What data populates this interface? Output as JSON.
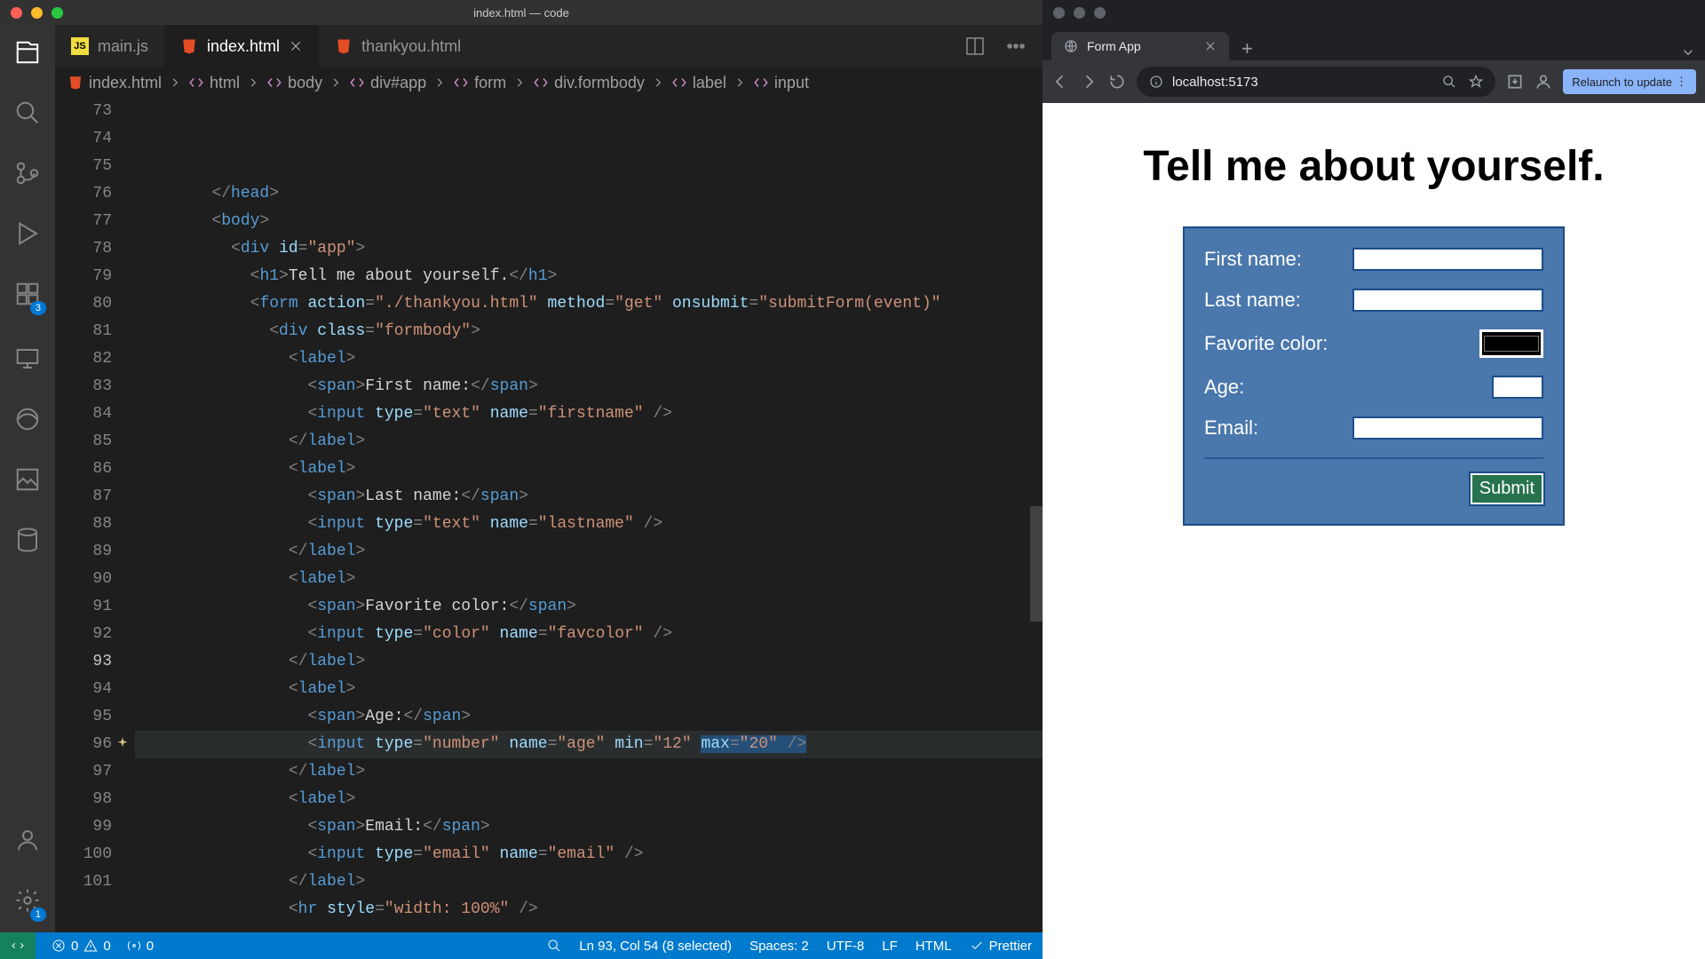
{
  "vscode": {
    "titlebar": "index.html — code",
    "tabs": [
      {
        "label": "main.js",
        "icon_color": "#f1dd3f",
        "icon_text": "JS",
        "active": false,
        "close": false
      },
      {
        "label": "index.html",
        "icon_color": "#e44d26",
        "active": true,
        "close": true
      },
      {
        "label": "thankyou.html",
        "icon_color": "#e44d26",
        "active": false,
        "close": false
      }
    ],
    "breadcrumbs": [
      {
        "label": "index.html",
        "kind": "file"
      },
      {
        "label": "html",
        "kind": "tag"
      },
      {
        "label": "body",
        "kind": "tag"
      },
      {
        "label": "div#app",
        "kind": "tag"
      },
      {
        "label": "form",
        "kind": "tag"
      },
      {
        "label": "div.formbody",
        "kind": "tag"
      },
      {
        "label": "label",
        "kind": "tag"
      },
      {
        "label": "input",
        "kind": "tag"
      }
    ],
    "activity_badges": {
      "extensions": "3",
      "settings": "1"
    },
    "code": {
      "first_line": 73,
      "cursor_line": 93,
      "lines": [
        {
          "n": 73,
          "indent": 8,
          "tokens": [
            "</",
            "head",
            ">"
          ],
          "kinds": [
            "punc",
            "tag",
            "punc"
          ]
        },
        {
          "n": 74,
          "indent": 8,
          "tokens": [
            "<",
            "body",
            ">"
          ],
          "kinds": [
            "punc",
            "tag",
            "punc"
          ]
        },
        {
          "n": 75,
          "indent": 10,
          "tokens": [
            "<",
            "div",
            " ",
            "id",
            "=",
            "\"app\"",
            ">"
          ],
          "kinds": [
            "punc",
            "tag",
            "txt",
            "attr",
            "punc",
            "str",
            "punc"
          ]
        },
        {
          "n": 76,
          "indent": 12,
          "tokens": [
            "<",
            "h1",
            ">",
            "Tell me about yourself.",
            "</",
            "h1",
            ">"
          ],
          "kinds": [
            "punc",
            "tag",
            "punc",
            "txt",
            "punc",
            "tag",
            "punc"
          ]
        },
        {
          "n": 77,
          "indent": 12,
          "tokens": [
            "<",
            "form",
            " ",
            "action",
            "=",
            "\"./thankyou.html\"",
            " ",
            "method",
            "=",
            "\"get\"",
            " ",
            "onsubmit",
            "=",
            "\"submitForm(event)\""
          ],
          "kinds": [
            "punc",
            "tag",
            "txt",
            "attr",
            "punc",
            "str",
            "txt",
            "attr",
            "punc",
            "str",
            "txt",
            "attr",
            "punc",
            "str"
          ]
        },
        {
          "n": 78,
          "indent": 14,
          "tokens": [
            "<",
            "div",
            " ",
            "class",
            "=",
            "\"formbody\"",
            ">"
          ],
          "kinds": [
            "punc",
            "tag",
            "txt",
            "attr",
            "punc",
            "str",
            "punc"
          ]
        },
        {
          "n": 79,
          "indent": 16,
          "tokens": [
            "<",
            "label",
            ">"
          ],
          "kinds": [
            "punc",
            "tag",
            "punc"
          ]
        },
        {
          "n": 80,
          "indent": 18,
          "tokens": [
            "<",
            "span",
            ">",
            "First name:",
            "</",
            "span",
            ">"
          ],
          "kinds": [
            "punc",
            "tag",
            "punc",
            "txt",
            "punc",
            "tag",
            "punc"
          ]
        },
        {
          "n": 81,
          "indent": 18,
          "tokens": [
            "<",
            "input",
            " ",
            "type",
            "=",
            "\"text\"",
            " ",
            "name",
            "=",
            "\"firstname\"",
            " />"
          ],
          "kinds": [
            "punc",
            "tag",
            "txt",
            "attr",
            "punc",
            "str",
            "txt",
            "attr",
            "punc",
            "str",
            "punc"
          ]
        },
        {
          "n": 82,
          "indent": 16,
          "tokens": [
            "</",
            "label",
            ">"
          ],
          "kinds": [
            "punc",
            "tag",
            "punc"
          ]
        },
        {
          "n": 83,
          "indent": 16,
          "tokens": [
            "<",
            "label",
            ">"
          ],
          "kinds": [
            "punc",
            "tag",
            "punc"
          ]
        },
        {
          "n": 84,
          "indent": 18,
          "tokens": [
            "<",
            "span",
            ">",
            "Last name:",
            "</",
            "span",
            ">"
          ],
          "kinds": [
            "punc",
            "tag",
            "punc",
            "txt",
            "punc",
            "tag",
            "punc"
          ]
        },
        {
          "n": 85,
          "indent": 18,
          "tokens": [
            "<",
            "input",
            " ",
            "type",
            "=",
            "\"text\"",
            " ",
            "name",
            "=",
            "\"lastname\"",
            " />"
          ],
          "kinds": [
            "punc",
            "tag",
            "txt",
            "attr",
            "punc",
            "str",
            "txt",
            "attr",
            "punc",
            "str",
            "punc"
          ]
        },
        {
          "n": 86,
          "indent": 16,
          "tokens": [
            "</",
            "label",
            ">"
          ],
          "kinds": [
            "punc",
            "tag",
            "punc"
          ]
        },
        {
          "n": 87,
          "indent": 16,
          "tokens": [
            "<",
            "label",
            ">"
          ],
          "kinds": [
            "punc",
            "tag",
            "punc"
          ]
        },
        {
          "n": 88,
          "indent": 18,
          "tokens": [
            "<",
            "span",
            ">",
            "Favorite color:",
            "</",
            "span",
            ">"
          ],
          "kinds": [
            "punc",
            "tag",
            "punc",
            "txt",
            "punc",
            "tag",
            "punc"
          ]
        },
        {
          "n": 89,
          "indent": 18,
          "tokens": [
            "<",
            "input",
            " ",
            "type",
            "=",
            "\"color\"",
            " ",
            "name",
            "=",
            "\"favcolor\"",
            " />"
          ],
          "kinds": [
            "punc",
            "tag",
            "txt",
            "attr",
            "punc",
            "str",
            "txt",
            "attr",
            "punc",
            "str",
            "punc"
          ]
        },
        {
          "n": 90,
          "indent": 16,
          "tokens": [
            "</",
            "label",
            ">"
          ],
          "kinds": [
            "punc",
            "tag",
            "punc"
          ]
        },
        {
          "n": 91,
          "indent": 16,
          "tokens": [
            "<",
            "label",
            ">"
          ],
          "kinds": [
            "punc",
            "tag",
            "punc"
          ]
        },
        {
          "n": 92,
          "indent": 18,
          "tokens": [
            "<",
            "span",
            ">",
            "Age:",
            "</",
            "span",
            ">"
          ],
          "kinds": [
            "punc",
            "tag",
            "punc",
            "txt",
            "punc",
            "tag",
            "punc"
          ]
        },
        {
          "n": 93,
          "indent": 18,
          "tokens": [
            "<",
            "input",
            " ",
            "type",
            "=",
            "\"number\"",
            " ",
            "name",
            "=",
            "\"age\"",
            " ",
            "min",
            "=",
            "\"12\"",
            " ",
            "max",
            "=",
            "\"20\"",
            " />"
          ],
          "kinds": [
            "punc",
            "tag",
            "txt",
            "attr",
            "punc",
            "str",
            "txt",
            "attr",
            "punc",
            "str",
            "txt",
            "attr",
            "punc",
            "str",
            "txt",
            "attr",
            "punc",
            "str",
            "punc"
          ],
          "sel_from": 15,
          "sel_to": 18
        },
        {
          "n": 94,
          "indent": 16,
          "tokens": [
            "</",
            "label",
            ">"
          ],
          "kinds": [
            "punc",
            "tag",
            "punc"
          ]
        },
        {
          "n": 95,
          "indent": 0,
          "tokens": [
            ""
          ],
          "kinds": [
            "txt"
          ]
        },
        {
          "n": 96,
          "indent": 16,
          "tokens": [
            "<",
            "label",
            ">"
          ],
          "kinds": [
            "punc",
            "tag",
            "punc"
          ]
        },
        {
          "n": 97,
          "indent": 18,
          "tokens": [
            "<",
            "span",
            ">",
            "Email:",
            "</",
            "span",
            ">"
          ],
          "kinds": [
            "punc",
            "tag",
            "punc",
            "txt",
            "punc",
            "tag",
            "punc"
          ]
        },
        {
          "n": 98,
          "indent": 18,
          "tokens": [
            "<",
            "input",
            " ",
            "type",
            "=",
            "\"email\"",
            " ",
            "name",
            "=",
            "\"email\"",
            " />"
          ],
          "kinds": [
            "punc",
            "tag",
            "txt",
            "attr",
            "punc",
            "str",
            "txt",
            "attr",
            "punc",
            "str",
            "punc"
          ]
        },
        {
          "n": 99,
          "indent": 16,
          "tokens": [
            "</",
            "label",
            ">"
          ],
          "kinds": [
            "punc",
            "tag",
            "punc"
          ]
        },
        {
          "n": 100,
          "indent": 0,
          "tokens": [
            ""
          ],
          "kinds": [
            "txt"
          ]
        },
        {
          "n": 101,
          "indent": 16,
          "tokens": [
            "<",
            "hr",
            " ",
            "style",
            "=",
            "\"width: 100%\"",
            " />"
          ],
          "kinds": [
            "punc",
            "tag",
            "txt",
            "attr",
            "punc",
            "str",
            "punc"
          ]
        }
      ]
    },
    "status": {
      "errors": "0",
      "warnings": "0",
      "ports": "0",
      "cursor": "Ln 93, Col 54 (8 selected)",
      "spaces": "Spaces: 2",
      "encoding": "UTF-8",
      "eol": "LF",
      "language": "HTML",
      "formatter": "Prettier"
    }
  },
  "browser": {
    "tab_title": "Form App",
    "url": "localhost:5173",
    "relaunch": "Relaunch to update"
  },
  "page": {
    "heading": "Tell me about yourself.",
    "fields": {
      "firstname": "First name:",
      "lastname": "Last name:",
      "favcolor": "Favorite color:",
      "age": "Age:",
      "email": "Email:"
    },
    "submit": "Submit"
  }
}
